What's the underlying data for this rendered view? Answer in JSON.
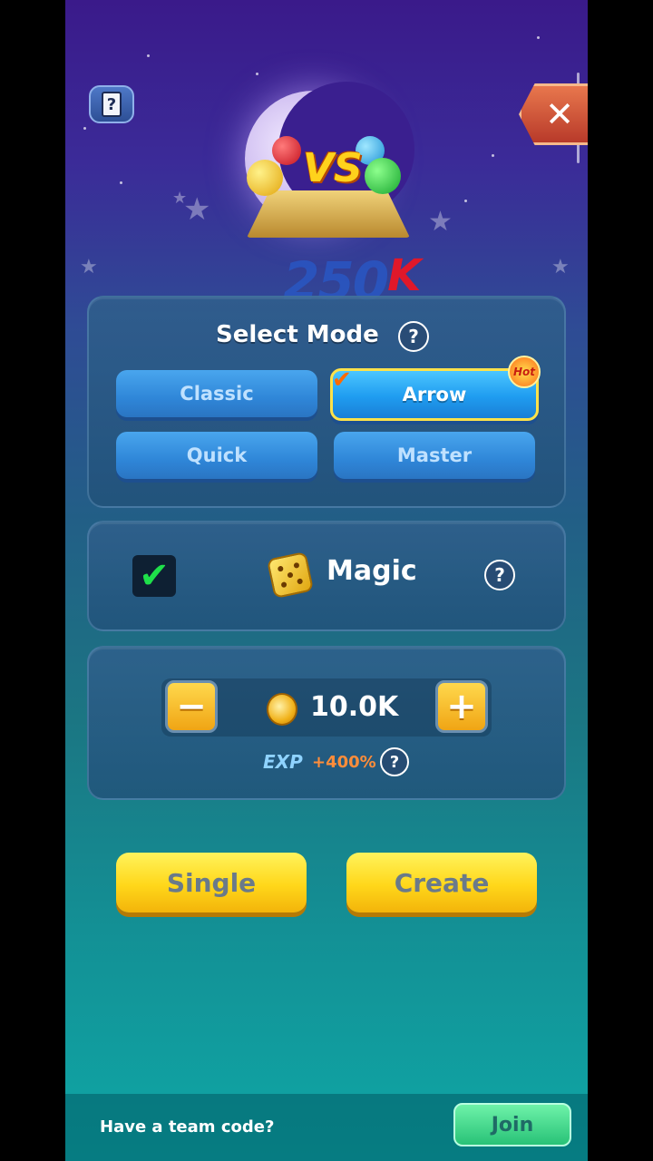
{
  "top": {
    "help_icon": "card-question-icon",
    "close_icon": "close-icon",
    "close_glyph": "✕"
  },
  "hero": {
    "vs_text": "VS",
    "prize_amount": "250",
    "prize_suffix": "K"
  },
  "mode": {
    "title": "Select Mode",
    "help_glyph": "?",
    "options": [
      {
        "label": "Classic",
        "selected": false
      },
      {
        "label": "Arrow",
        "selected": true,
        "badge": "Hot"
      },
      {
        "label": "Quick",
        "selected": false
      },
      {
        "label": "Master",
        "selected": false
      }
    ]
  },
  "magic": {
    "checked": true,
    "check_glyph": "✔",
    "label": "Magic",
    "help_glyph": "?"
  },
  "bet": {
    "minus_glyph": "−",
    "plus_glyph": "+",
    "amount": "10.0K",
    "exp_label": "EXP",
    "exp_bonus": "+400%",
    "help_glyph": "?"
  },
  "actions": {
    "single_label": "Single",
    "create_label": "Create"
  },
  "footer": {
    "team_code_text": "Have a team code?",
    "join_label": "Join"
  },
  "colors": {
    "accent_yellow": "#ffd71a",
    "mode_blue": "#2f86d8",
    "join_green": "#28c277"
  }
}
